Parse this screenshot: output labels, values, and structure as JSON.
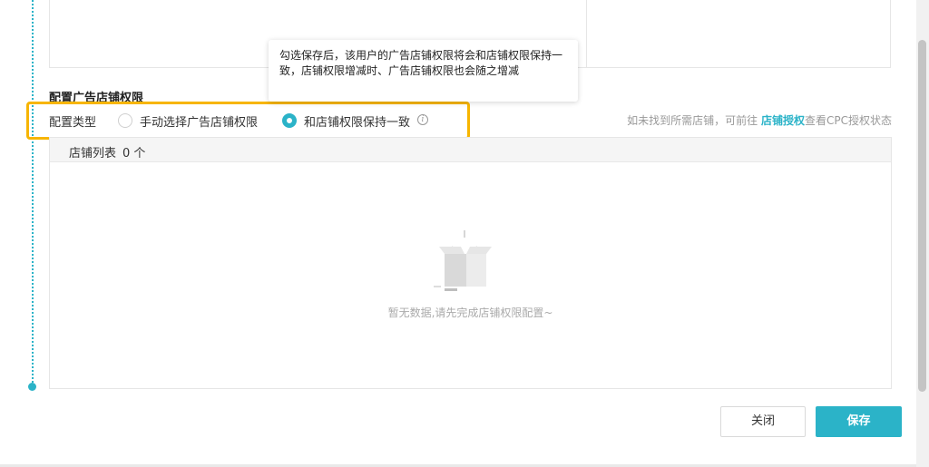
{
  "section": {
    "title": "配置广告店铺权限"
  },
  "config": {
    "label": "配置类型",
    "options": [
      {
        "label": "手动选择广告店铺权限",
        "selected": false
      },
      {
        "label": "和店铺权限保持一致",
        "selected": true
      }
    ]
  },
  "tooltip": {
    "text": "勾选保存后，该用户的广告店铺权限将会和店铺权限保持一致，店铺权限增减时、广告店铺权限也会随之增减"
  },
  "hint": {
    "prefix": "如未找到所需店铺，可前往 ",
    "link": "店铺授权",
    "suffix": "查看CPC授权状态"
  },
  "store_list": {
    "header_label": "店铺列表",
    "count": "0 个",
    "empty_text": "暂无数据,请先完成店铺权限配置~"
  },
  "footer": {
    "close_label": "关闭",
    "save_label": "保存"
  },
  "colors": {
    "accent": "#2bb3c8",
    "highlight": "#f7b500"
  }
}
